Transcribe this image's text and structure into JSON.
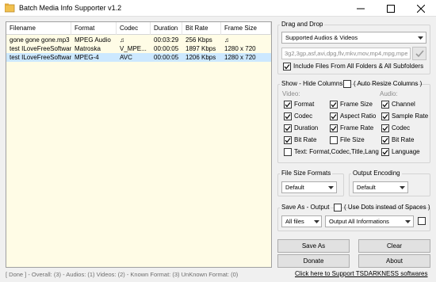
{
  "window": {
    "title": "Batch Media Info Supporter v1.2",
    "minimize_glyph": "—",
    "maximize_glyph": "☐",
    "close_glyph": "✕"
  },
  "file_list": {
    "columns": [
      "Filename",
      "Format",
      "Codec",
      "Duration",
      "Bit Rate",
      "Frame Size"
    ],
    "rows": [
      [
        "gone gone gone.mp3",
        "MPEG Audio",
        "♫",
        "00:03:29",
        "256 Kbps",
        "♫"
      ],
      [
        "test ILoveFreeSoftware...",
        "Matroska",
        "V_MPE...",
        "00:00:05",
        "1897 Kbps",
        "1280 x 720"
      ],
      [
        "test ILoveFreeSoftware...",
        "MPEG-4",
        "AVC",
        "00:00:05",
        "1206 Kbps",
        "1280 x 720"
      ]
    ],
    "selected_row": 2
  },
  "status_bar": "[ Done ]  -  Overall: (3)  -  Audios: (1) Videos: (2)  -  Known Format: (3) UnKnown Format: (0)",
  "drag_drop": {
    "title": "Drag and Drop",
    "type_selected": "Supported Audios & Videos",
    "extensions": "3g2,3gp,asf,avi,dpg,flv,mkv,mov,mp4,mpg,mpeg,o...",
    "include_subfolders_label": "Include Files From All Folders & All Subfolders",
    "include_subfolders": true
  },
  "columns_panel": {
    "title": "Show - Hide Columns",
    "auto_resize_label": "( Auto Resize Columns )",
    "auto_resize": false,
    "video_heading": "Video:",
    "audio_heading": "Audio:",
    "video_col1": [
      {
        "label": "Format",
        "checked": true
      },
      {
        "label": "Codec",
        "checked": true
      },
      {
        "label": "Duration",
        "checked": true
      },
      {
        "label": "Bit Rate",
        "checked": true
      }
    ],
    "video_col2": [
      {
        "label": "Frame Size",
        "checked": true
      },
      {
        "label": "Aspect Ratio",
        "checked": true
      },
      {
        "label": "Frame Rate",
        "checked": true
      },
      {
        "label": "File Size",
        "checked": false
      }
    ],
    "audio_col": [
      {
        "label": "Channel",
        "checked": true
      },
      {
        "label": "Sample Rate",
        "checked": true
      },
      {
        "label": "Codec",
        "checked": true
      },
      {
        "label": "Bit Rate",
        "checked": true
      },
      {
        "label": "Language",
        "checked": true
      }
    ],
    "text_option": {
      "label": "Text: Format,Codec,Title,Lang",
      "checked": false
    }
  },
  "file_size_formats": {
    "title": "File Size Formats",
    "selected": "Default"
  },
  "output_encoding": {
    "title": "Output Encoding",
    "selected": "Default"
  },
  "save_as": {
    "title": "Save As - Output",
    "use_dots_label": "( Use Dots instead of Spaces )",
    "use_dots": false,
    "files_selected": "All files",
    "output_selected": "Output All Informations",
    "extra_checked": false
  },
  "buttons": {
    "save_as": "Save As",
    "clear": "Clear",
    "donate": "Donate",
    "about": "About"
  },
  "support_link": "Click here to Support TSDARKNESS softwares"
}
